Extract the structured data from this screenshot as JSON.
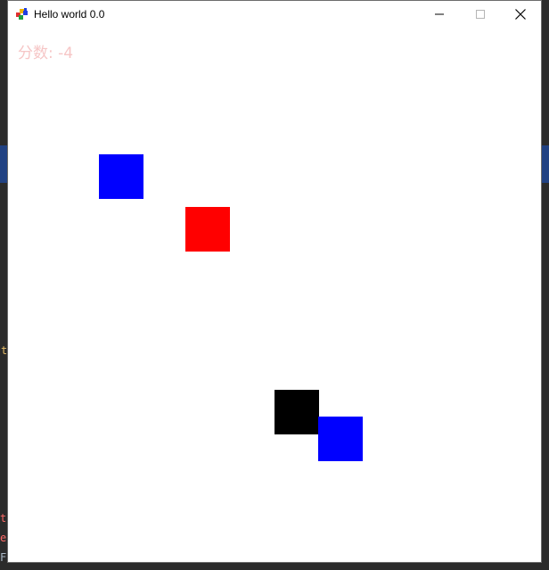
{
  "window": {
    "title": "Hello world 0.0"
  },
  "game": {
    "score_label": "分数: ",
    "score_value": "-4",
    "score_color": "#f6c6c6",
    "blocks": [
      {
        "name": "enemy-block-1",
        "color": "#0000ff"
      },
      {
        "name": "target-block",
        "color": "#ff0000"
      },
      {
        "name": "player-block",
        "color": "#000000"
      },
      {
        "name": "enemy-block-2",
        "color": "#0000ff"
      }
    ]
  },
  "icons": {
    "app": "app-puzzle-icon",
    "minimize": "minimize-icon",
    "maximize": "maximize-icon",
    "close": "close-icon"
  }
}
